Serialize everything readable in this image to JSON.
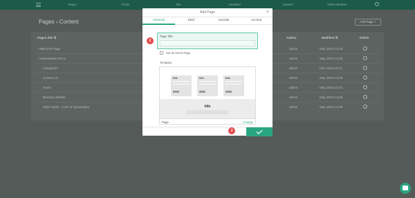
{
  "topbar": {
    "nav": [
      "Pages",
      "Posts",
      "Site",
      "Modules",
      "System",
      "Administration"
    ]
  },
  "page": {
    "title": "Pages › Content",
    "add_page_label": "Add Page  +"
  },
  "table": {
    "headers": {
      "title": "Pages title  ⇅",
      "author": "Author",
      "modified": "Modified  ⇅",
      "delete": "Delete"
    },
    "rows": [
      {
        "title": "›  Welcome Page",
        "author": "admin",
        "date": "May 15/24 14:33"
      },
      {
        "title": "›  Subtemplate Demo",
        "author": "admin",
        "date": "May 15/24 14:33"
      },
      {
        "title": "Categories",
        "author": "admin",
        "date": "Feb 15/24 10:14"
      },
      {
        "title": "Contact Us",
        "author": "admin",
        "date": "May 15/24 14:26"
      },
      {
        "title": "Home",
        "author": "admin",
        "date": "May 15/24 14:31"
      },
      {
        "title": "Blossary Details",
        "author": "admin",
        "date": "May 15/24 14:26"
      },
      {
        "title": "Style Guide · Color & Typography",
        "author": "admin",
        "date": "May 15/24 14:26"
      }
    ]
  },
  "modal": {
    "title": "Add Page",
    "tabs": [
      "General",
      "SEO",
      "Socials",
      "Access"
    ],
    "active_tab": "General",
    "page_title_label": "Page Title:",
    "page_title_value": "",
    "home_checkbox_label": "Set as Home Page",
    "home_checked": false,
    "template_label": "Template:",
    "thumb_titles": [
      "title",
      "title",
      "title"
    ],
    "preview_title": "title",
    "template_name": "Page",
    "change_label": "Change"
  },
  "steps": [
    "2",
    "3"
  ],
  "colors": {
    "accent": "#2aa582",
    "topbar": "#1c5a49",
    "badge": "#e24b4b"
  }
}
